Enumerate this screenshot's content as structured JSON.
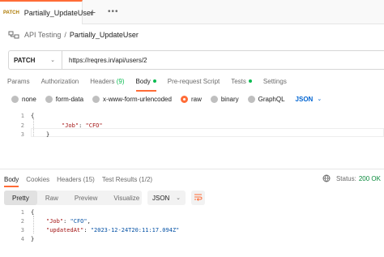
{
  "tab": {
    "method": "PATCH",
    "name": "Partially_UpdateUser",
    "add_label": "+",
    "more_label": "•••"
  },
  "breadcrumb": {
    "collection": "API Testing",
    "separator": "/",
    "request": "Partially_UpdateUser"
  },
  "request": {
    "method": "PATCH",
    "url": "https://reqres.in/api/users/2",
    "tabs": {
      "params": "Params",
      "authorization": "Authorization",
      "headers": "Headers",
      "headers_count": "(9)",
      "body": "Body",
      "prerequest": "Pre-request Script",
      "tests": "Tests",
      "settings": "Settings"
    },
    "body_types": [
      "none",
      "form-data",
      "x-www-form-urlencoded",
      "raw",
      "binary",
      "GraphQL"
    ],
    "body_format": "JSON",
    "body_lines": {
      "l1": {
        "num": "1",
        "text": "{"
      },
      "l2": {
        "num": "2",
        "key": "\"Job\"",
        "colon": ": ",
        "value": "\"CFO\""
      },
      "l3": {
        "num": "3",
        "text": "}"
      }
    }
  },
  "response": {
    "tabs": {
      "body": "Body",
      "cookies": "Cookies",
      "headers": "Headers (15)",
      "test_results": "Test Results (1/2)"
    },
    "status_label": "Status:",
    "status_value": "200 OK",
    "view_modes": [
      "Pretty",
      "Raw",
      "Preview",
      "Visualize"
    ],
    "format": "JSON",
    "body_lines": {
      "l1": {
        "num": "1",
        "text": "{"
      },
      "l2": {
        "num": "2",
        "key": "\"Job\"",
        "colon": ": ",
        "value": "\"CFO\"",
        "comma": ","
      },
      "l3": {
        "num": "3",
        "key": "\"updatedAt\"",
        "colon": ": ",
        "value": "\"2023-12-24T20:11:17.094Z\""
      },
      "l4": {
        "num": "4",
        "text": "}"
      }
    }
  },
  "colors": {
    "accent": "#ff6c37",
    "success": "#0cbb52",
    "link": "#0265d2",
    "method_patch": "#ad7a03"
  },
  "icons": [
    "collection-icon",
    "chevron-down-icon",
    "globe-icon",
    "wrap-lines-icon"
  ]
}
